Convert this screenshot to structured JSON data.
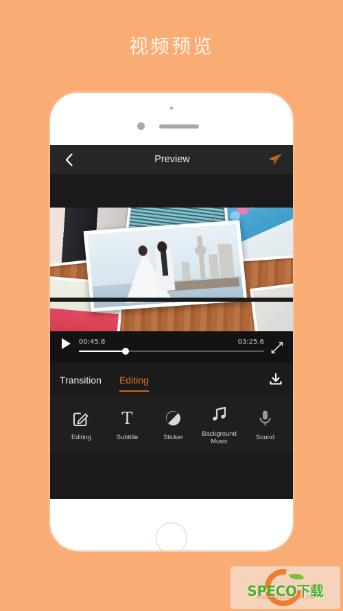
{
  "page": {
    "title": "视频预览",
    "background_color": "#f9ac74"
  },
  "phone": {
    "frame_color": "#ffffff",
    "home_button": "home-button"
  },
  "app": {
    "nav": {
      "back_icon": "chevron-left-icon",
      "title": "Preview",
      "send_icon": "paper-plane-icon",
      "send_color": "#c56a2c",
      "background": "#262626"
    },
    "player": {
      "volume_icon": "speaker-volume-icon",
      "play_icon": "play-icon",
      "current_time": "00:45.8",
      "total_time": "03:25.6",
      "progress_percent": 25,
      "expand_icon": "fullscreen-expand-icon"
    },
    "tabs": {
      "items": [
        {
          "label": "Transition",
          "active": false
        },
        {
          "label": "Editing",
          "active": true
        }
      ],
      "active_color": "#e2731f",
      "download_icon": "download-icon"
    },
    "toolbar": {
      "items": [
        {
          "label": "Editing",
          "icon": "pencil-square-icon"
        },
        {
          "label": "Subtitle",
          "icon": "text-t-icon"
        },
        {
          "label": "Sticker",
          "icon": "circle-slash-icon"
        },
        {
          "label": "Background\nMusic",
          "icon": "music-note-icon"
        },
        {
          "label": "Sound",
          "icon": "microphone-icon"
        }
      ]
    }
  },
  "watermark": {
    "brand": "SPECO下载",
    "url": "WWW.SPECO.COM.CN",
    "brand_color": "#4caf2f",
    "accent_color": "#ef7b2f"
  }
}
